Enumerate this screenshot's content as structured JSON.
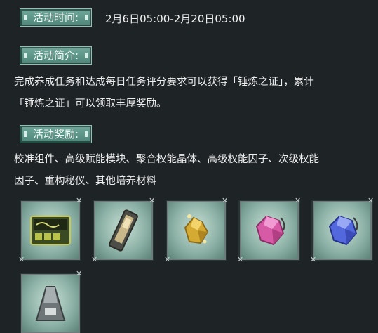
{
  "event": {
    "time_label": "活动时间:",
    "time_value": "2月6日05:00-2月20日05:00",
    "intro_label": "活动简介:",
    "intro_line1": "完成养成任务和达成每日任务评分要求可以获得「锤炼之证」，累计",
    "intro_line2": "「锤炼之证」可以领取丰厚奖励。",
    "rewards_label": "活动奖励:",
    "rewards_line1": "校准组件、高级赋能模块、聚合权能晶体、高级权能因子、次级权能",
    "rewards_line2": "因子、重构秘仪、其他培养材料"
  },
  "reward_items": [
    {
      "icon": "calibration-kit-icon",
      "color": "#2c3a1c"
    },
    {
      "icon": "enhancement-module-icon",
      "color": "#5a5a50"
    },
    {
      "icon": "aggregate-crystal-icon",
      "color": "#d9b43a"
    },
    {
      "icon": "advanced-factor-icon",
      "color": "#d95aa8"
    },
    {
      "icon": "secondary-factor-icon",
      "color": "#5a6ee0"
    },
    {
      "icon": "reconstruction-ritual-icon",
      "color": "#7d8486"
    }
  ],
  "colors": {
    "background": "#1e2326",
    "tag_fill": "#5f9a8c",
    "slot_border": "#6b7d7a"
  }
}
